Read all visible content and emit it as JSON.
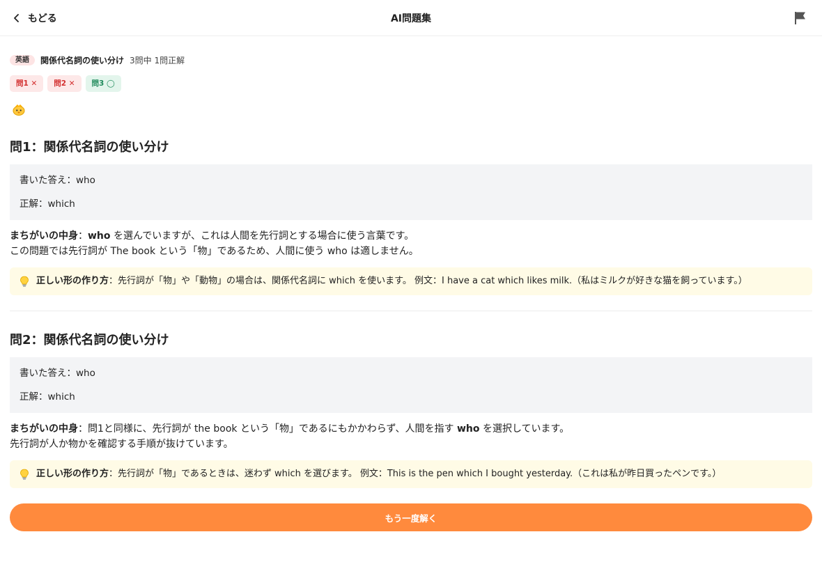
{
  "header": {
    "back_label": "もどる",
    "title": "AI問題集",
    "flag_icon": "flag-icon"
  },
  "summary": {
    "subject": "英語",
    "set_title": "関係代名詞の使い分け",
    "score": "3問中 1問正解"
  },
  "result_chips": [
    {
      "label": "問1 ✕",
      "status": "wrong"
    },
    {
      "label": "問2 ✕",
      "status": "wrong"
    },
    {
      "label": "問3 ◯",
      "status": "correct"
    }
  ],
  "questions": [
    {
      "title": "問1：関係代名詞の使い分け",
      "your_answer": "書いた答え：who",
      "correct_answer": "正解：which",
      "mistake_label": "まちがいの中身",
      "mistake_pre": "：",
      "mistake_bold_word": "who",
      "mistake_line1_rest": " を選んでいますが、これは人間を先行詞とする場合に使う言葉です。",
      "mistake_line2": "この問題では先行詞が The book という「物」であるため、人間に使う who は適しません。",
      "tip_label": "正しい形の作り方",
      "tip_text": "：先行詞が「物」や「動物」の場合は、関係代名詞に which を使います。 例文：I have a cat which likes milk.（私はミルクが好きな猫を飼っています。）"
    },
    {
      "title": "問2：関係代名詞の使い分け",
      "your_answer": "書いた答え：who",
      "correct_answer": "正解：which",
      "mistake_label": "まちがいの中身",
      "mistake_line1_pre": "：問1と同様に、先行詞が the book という「物」であるにもかかわらず、人間を指す ",
      "mistake_bold_word": "who",
      "mistake_line1_rest": " を選択しています。",
      "mistake_line2": "先行詞が人か物かを確認する手順が抜けています。",
      "tip_label": "正しい形の作り方",
      "tip_text": "：先行詞が「物」であるときは、迷わず which を選びます。 例文：This is the pen which I bought yesterday.（これは私が昨日買ったペンです。）"
    }
  ],
  "retry_label": "もう一度解く",
  "colors": {
    "accent": "#ff8a3d",
    "wrong": "#d32f2f",
    "correct": "#1f8a5b"
  }
}
